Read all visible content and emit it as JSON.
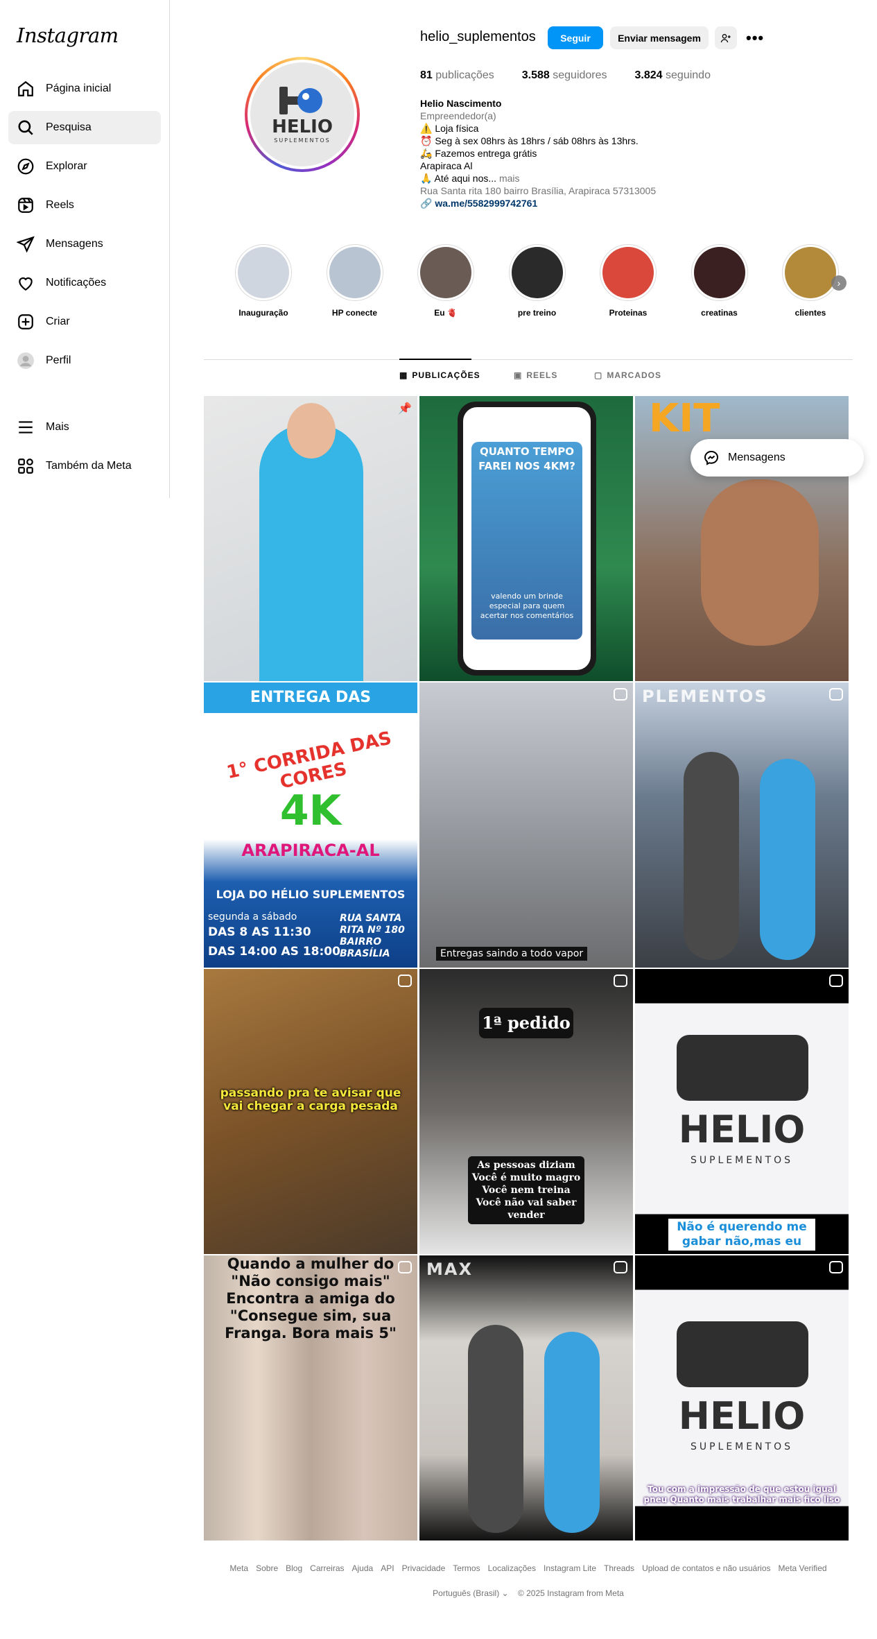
{
  "app": {
    "logo": "Instagram"
  },
  "sidebar": {
    "items": [
      {
        "label": "Página inicial",
        "icon": "home-icon"
      },
      {
        "label": "Pesquisa",
        "icon": "search-icon"
      },
      {
        "label": "Explorar",
        "icon": "compass-icon"
      },
      {
        "label": "Reels",
        "icon": "reels-icon"
      },
      {
        "label": "Mensagens",
        "icon": "direct-icon"
      },
      {
        "label": "Notificações",
        "icon": "heart-icon"
      },
      {
        "label": "Criar",
        "icon": "plus-square-icon"
      },
      {
        "label": "Perfil",
        "icon": "profile-avatar-icon"
      },
      {
        "label": "Mais",
        "icon": "menu-icon"
      },
      {
        "label": "Também da Meta",
        "icon": "meta-grid-icon"
      }
    ],
    "active": "Pesquisa"
  },
  "profile": {
    "username": "helio_suplementos",
    "follow_label": "Seguir",
    "message_label": "Enviar mensagem",
    "stats": {
      "posts": "81",
      "posts_label": "publicações",
      "followers": "3.588",
      "followers_label": "seguidores",
      "following": "3.824",
      "following_label": "seguindo"
    },
    "name": "Helio Nascimento",
    "category": "Empreendedor(a)",
    "bio_lines": [
      "⚠️ Loja física",
      "⏰ Seg à sex 08hrs às 18hrs / sáb 08hrs às 13hrs.",
      "🛵 Fazemos entrega grátis",
      "Arapiraca Al",
      "🙏 Até aqui nos..."
    ],
    "more": "mais",
    "address": "Rua Santa rita 180 bairro Brasília, Arapiraca 57313005",
    "link": "wa.me/5582999742761",
    "avatar_text": {
      "big": "HELIO",
      "small": "SUPLEMENTOS"
    }
  },
  "highlights": [
    {
      "label": "Inauguração",
      "color": "#cfd6e0"
    },
    {
      "label": "HP conecte",
      "color": "#b9c4d2"
    },
    {
      "label": "Eu 🫀",
      "color": "#6b5b55"
    },
    {
      "label": "pre treino",
      "color": "#2a2a2a"
    },
    {
      "label": "Proteinas",
      "color": "#d9483b"
    },
    {
      "label": "creatinas",
      "color": "#3a2020"
    },
    {
      "label": "clientes",
      "color": "#b28a3a"
    }
  ],
  "tabs": [
    "PUBLICAÇÕES",
    "REELS",
    "MARCADOS"
  ],
  "posts": [
    {
      "bg": "linear-gradient(160deg,#e8e8e8 0%,#cfd4d8 100%)",
      "text": "",
      "type": "pinned"
    },
    {
      "bg": "linear-gradient(180deg,#1e6b3d 0%,#2f8a4f 60%,#0f4d2b 100%)",
      "text": "QUANTO TEMPO FAREI NOS 4KM?",
      "sub": "valendo um brinde especial para quem acertar nos comentários",
      "type": "phone"
    },
    {
      "bg": "linear-gradient(180deg,#9fb9cc 0%,#8c6f5c 60%,#6e5040 100%)",
      "text": "KIT",
      "type": "post"
    },
    {
      "bg": "linear-gradient(180deg,#ffffff 0%,#ffffff 55%,#1e5fb0 70%,#0d3f86 100%)",
      "text": "ENTREGA DAS NUMERAÇÃO",
      "sub": "1° CORRIDA DAS CORES",
      "big": "4K",
      "city": "ARAPIRACA-AL",
      "store": "LOJA DO HÉLIO SUPLEMENTOS",
      "hours1": "segunda a sábado",
      "hours2": "DAS 8 AS 11:30",
      "hours3": "DAS 14:00 AS 18:00",
      "addr": "RUA SANTA RITA Nº 180 BAIRRO BRASÍLIA",
      "type": "poster"
    },
    {
      "bg": "linear-gradient(180deg,#c8ccd2 0%,#8e9196 60%,#6b6c6e 100%)",
      "caption": "Entregas saindo a todo vapor",
      "type": "reel"
    },
    {
      "bg": "linear-gradient(180deg,#c7d2e0 0%,#6b7b8e 40%,#3b3f45 100%)",
      "text": "PLEMENTOS",
      "type": "reel"
    },
    {
      "bg": "linear-gradient(160deg,#a8793f 0%,#7a5228 50%,#4b3a2a 100%)",
      "caption": "passando pra te avisar que vai chegar a carga pesada",
      "type": "reel"
    },
    {
      "bg": "linear-gradient(180deg,#2b2b2b 0%,#6d6a67 50%,#e5e5e5 100%)",
      "title": "1ª pedido",
      "caption": "As pessoas diziam Você é muito magro Você nem treina Você não vai saber vender",
      "type": "reel"
    },
    {
      "bg": "linear-gradient(180deg,#000 0%,#000 12%,#f4f4f6 12%,#f4f4f6 86%,#000 86%)",
      "text": "HELIO",
      "sub": "SUPLEMENTOS",
      "caption": "Não é querendo me gabar não,mas eu",
      "type": "reel"
    },
    {
      "bg": "linear-gradient(90deg,#c0b4a8,#e6d7c9,#b9a79a,#d8c4b8,#c2b0a3)",
      "caption": "Quando a mulher do \"Não consigo mais\" Encontra a amiga do \"Consegue sim, sua Franga. Bora mais 5\"",
      "type": "reel"
    },
    {
      "bg": "linear-gradient(180deg,#111 0%,#d6d3ce 30%,#c9c4be 70%,#111 100%)",
      "text": "MAX",
      "type": "reel"
    },
    {
      "bg": "linear-gradient(180deg,#000 0%,#000 12%,#f4f4f6 12%,#f4f4f6 88%,#000 88%)",
      "text": "HELIO",
      "sub": "SUPLEMENTOS",
      "caption": "Tou com a impressão de que estou igual pneu Quanto mais trabalhar mais fico liso",
      "type": "reel"
    }
  ],
  "messages_float": {
    "label": "Mensagens"
  },
  "footer": {
    "links": [
      "Meta",
      "Sobre",
      "Blog",
      "Carreiras",
      "Ajuda",
      "API",
      "Privacidade",
      "Termos",
      "Localizações",
      "Instagram Lite",
      "Threads",
      "Upload de contatos e não usuários",
      "Meta Verified"
    ],
    "language": "Português (Brasil)",
    "copyright": "© 2025 Instagram from Meta"
  }
}
